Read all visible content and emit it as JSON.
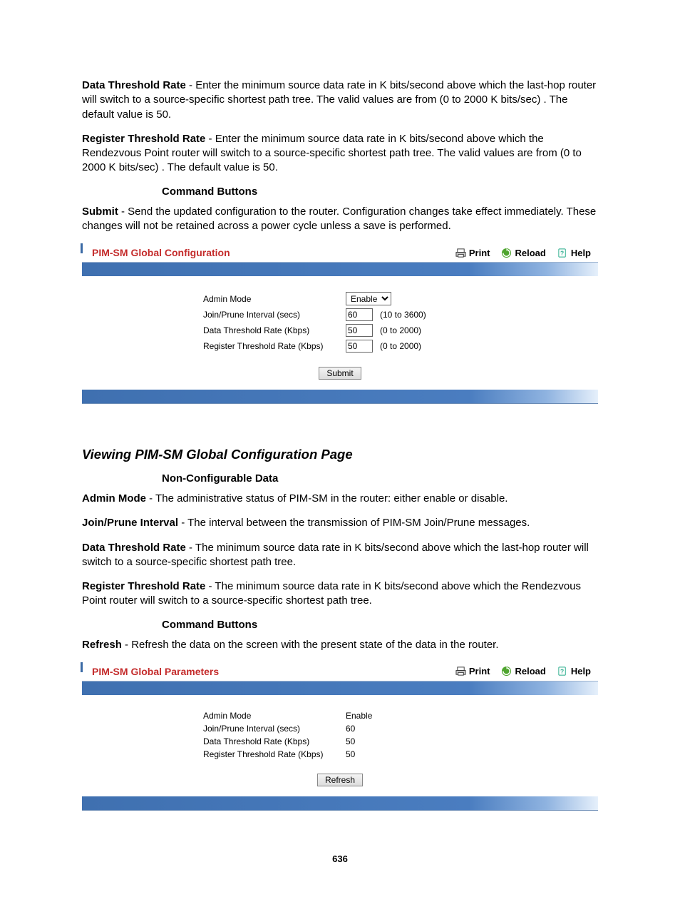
{
  "intro": {
    "p1": {
      "bold": "Data Threshold Rate",
      "text": " - Enter the minimum source data rate in K bits/second above which the last-hop router will switch to a source-specific shortest path tree. The valid values are from (0 to 2000 K bits/sec) . The default value is 50."
    },
    "p2": {
      "bold": "Register Threshold Rate",
      "text": " - Enter the minimum source data rate in K bits/second above which the Rendezvous Point router will switch to a source-specific shortest path tree. The valid values are from (0 to 2000 K bits/sec) . The default value is 50."
    },
    "cmd_h": "Command Buttons",
    "p3": {
      "bold": "Submit",
      "text": " - Send the updated configuration to the router. Configuration changes take effect immediately. These changes will not be retained across a power cycle unless a save is performed."
    }
  },
  "panel1": {
    "title": "PIM-SM Global Configuration",
    "actions": {
      "print": "Print",
      "reload": "Reload",
      "help": "Help"
    },
    "rows": {
      "admin": {
        "label": "Admin Mode",
        "value": "Enable"
      },
      "jp": {
        "label": "Join/Prune Interval (secs)",
        "value": "60",
        "hint": "(10 to 3600)"
      },
      "dtr": {
        "label": "Data Threshold Rate (Kbps)",
        "value": "50",
        "hint": "(0 to 2000)"
      },
      "rtr": {
        "label": "Register Threshold Rate (Kbps)",
        "value": "50",
        "hint": "(0 to 2000)"
      }
    },
    "submit": "Submit"
  },
  "section2": {
    "title": "Viewing PIM-SM Global Configuration Page",
    "non_conf_h": "Non-Configurable Data",
    "p1": {
      "bold": "Admin Mode",
      "text": " - The administrative status of PIM-SM in the router: either enable or disable."
    },
    "p2": {
      "bold": "Join/Prune Interval",
      "text": " - The interval between the transmission of PIM-SM Join/Prune messages."
    },
    "p3": {
      "bold": "Data Threshold Rate",
      "text": " - The minimum source data rate in K bits/second above which the last-hop router will switch to a source-specific shortest path tree."
    },
    "p4": {
      "bold": "Register Threshold Rate",
      "text": " - The minimum source data rate in K bits/second above which the Rendezvous Point router will switch to a source-specific shortest path tree."
    },
    "cmd_h": "Command Buttons",
    "p5": {
      "bold": "Refresh",
      "text": " - Refresh the data on the screen with the present state of the data in the router."
    }
  },
  "panel2": {
    "title": "PIM-SM Global Parameters",
    "actions": {
      "print": "Print",
      "reload": "Reload",
      "help": "Help"
    },
    "rows": {
      "admin": {
        "label": "Admin Mode",
        "value": "Enable"
      },
      "jp": {
        "label": "Join/Prune Interval (secs)",
        "value": "60"
      },
      "dtr": {
        "label": "Data Threshold Rate (Kbps)",
        "value": "50"
      },
      "rtr": {
        "label": "Register Threshold Rate (Kbps)",
        "value": "50"
      }
    },
    "refresh": "Refresh"
  },
  "page_number": "636"
}
